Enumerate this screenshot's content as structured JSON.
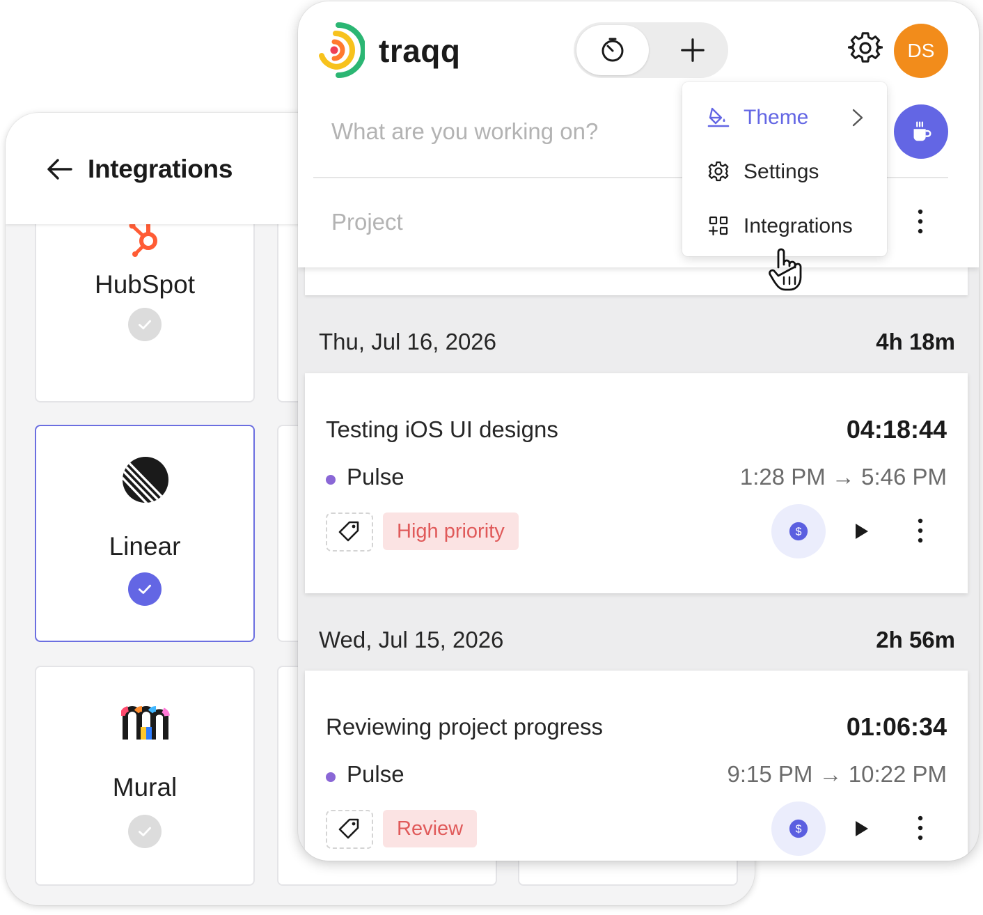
{
  "integrations_window": {
    "title": "Integrations",
    "cards": [
      {
        "name": "HubSpot",
        "connected": false
      },
      {
        "name": "Linear",
        "connected": true
      },
      {
        "name": "Mural",
        "connected": false
      }
    ]
  },
  "tracker": {
    "app_name": "traqq",
    "avatar_initials": "DS",
    "task_placeholder": "What are you working on?",
    "project_placeholder": "Project",
    "menu": {
      "items": [
        {
          "label": "Theme",
          "icon": "paint-bucket-icon",
          "has_submenu": true,
          "highlighted": true
        },
        {
          "label": "Settings",
          "icon": "gear-icon",
          "has_submenu": false,
          "highlighted": false
        },
        {
          "label": "Integrations",
          "icon": "grid-plus-icon",
          "has_submenu": false,
          "highlighted": false
        }
      ]
    },
    "days": [
      {
        "date": "Thu, Jul 16, 2026",
        "total": "4h 18m",
        "entries": [
          {
            "title": "Testing iOS UI designs",
            "duration": "04:18:44",
            "project": "Pulse",
            "time_range": "1:28 PM → 5:46 PM",
            "tag": "High priority"
          }
        ]
      },
      {
        "date": "Wed, Jul 15, 2026",
        "total": "2h 56m",
        "entries": [
          {
            "title": "Reviewing project progress",
            "duration": "01:06:34",
            "project": "Pulse",
            "time_range": "9:15 PM → 10:22 PM",
            "tag": "Review"
          }
        ]
      }
    ]
  },
  "colors": {
    "accent": "#6366e4",
    "avatar": "#f28c1b",
    "tag_text": "#e05a5a",
    "tag_bg": "#fbe3e3",
    "project_dot": "#8a67d6",
    "hubspot": "#ff5c35"
  }
}
